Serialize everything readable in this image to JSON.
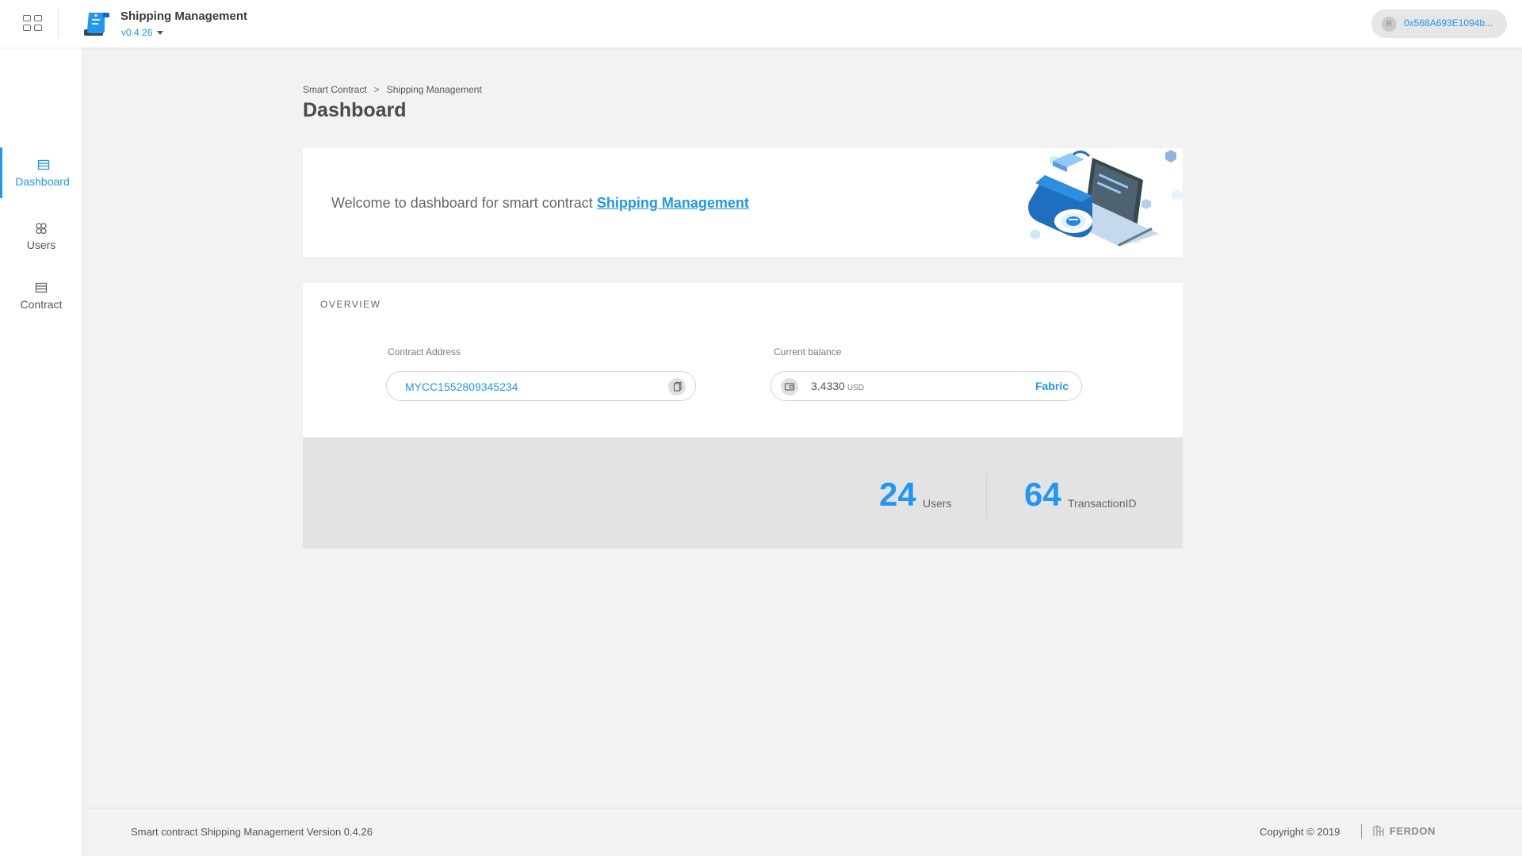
{
  "header": {
    "app_title": "Shipping Management",
    "version": "v0.4.26",
    "account_avatar_letter": "R",
    "account_address": "0x568A693E1094b..."
  },
  "sidebar": {
    "items": [
      {
        "label": "Dashboard",
        "icon": "dashboard-icon",
        "active": true
      },
      {
        "label": "Users",
        "icon": "users-icon",
        "active": false
      },
      {
        "label": "Contract",
        "icon": "contract-icon",
        "active": false
      }
    ]
  },
  "breadcrumb": {
    "items": [
      "Smart Contract",
      "Shipping Management"
    ],
    "separator": ">"
  },
  "page": {
    "title": "Dashboard"
  },
  "welcome": {
    "text": "Welcome to dashboard for smart contract",
    "link": "Shipping Management "
  },
  "overview": {
    "title": "OVERVIEW",
    "contract_address_label": "Contract Address",
    "contract_address": "MYCC1552809345234",
    "balance_label": "Current balance",
    "balance_value": "3.4330",
    "balance_unit": "USD",
    "network": "Fabric"
  },
  "stats": [
    {
      "value": "24",
      "label": "Users"
    },
    {
      "value": "64",
      "label": "TransactionID"
    }
  ],
  "footer": {
    "left_text": "Smart contract Shipping Management Version 0.4.26",
    "copyright": "Copyright © 2019",
    "brand": "FERDON"
  },
  "colors": {
    "accent": "#2196f3",
    "background": "#f2f2f2",
    "card": "#ffffff",
    "stats_band": "#e3e3e3"
  }
}
